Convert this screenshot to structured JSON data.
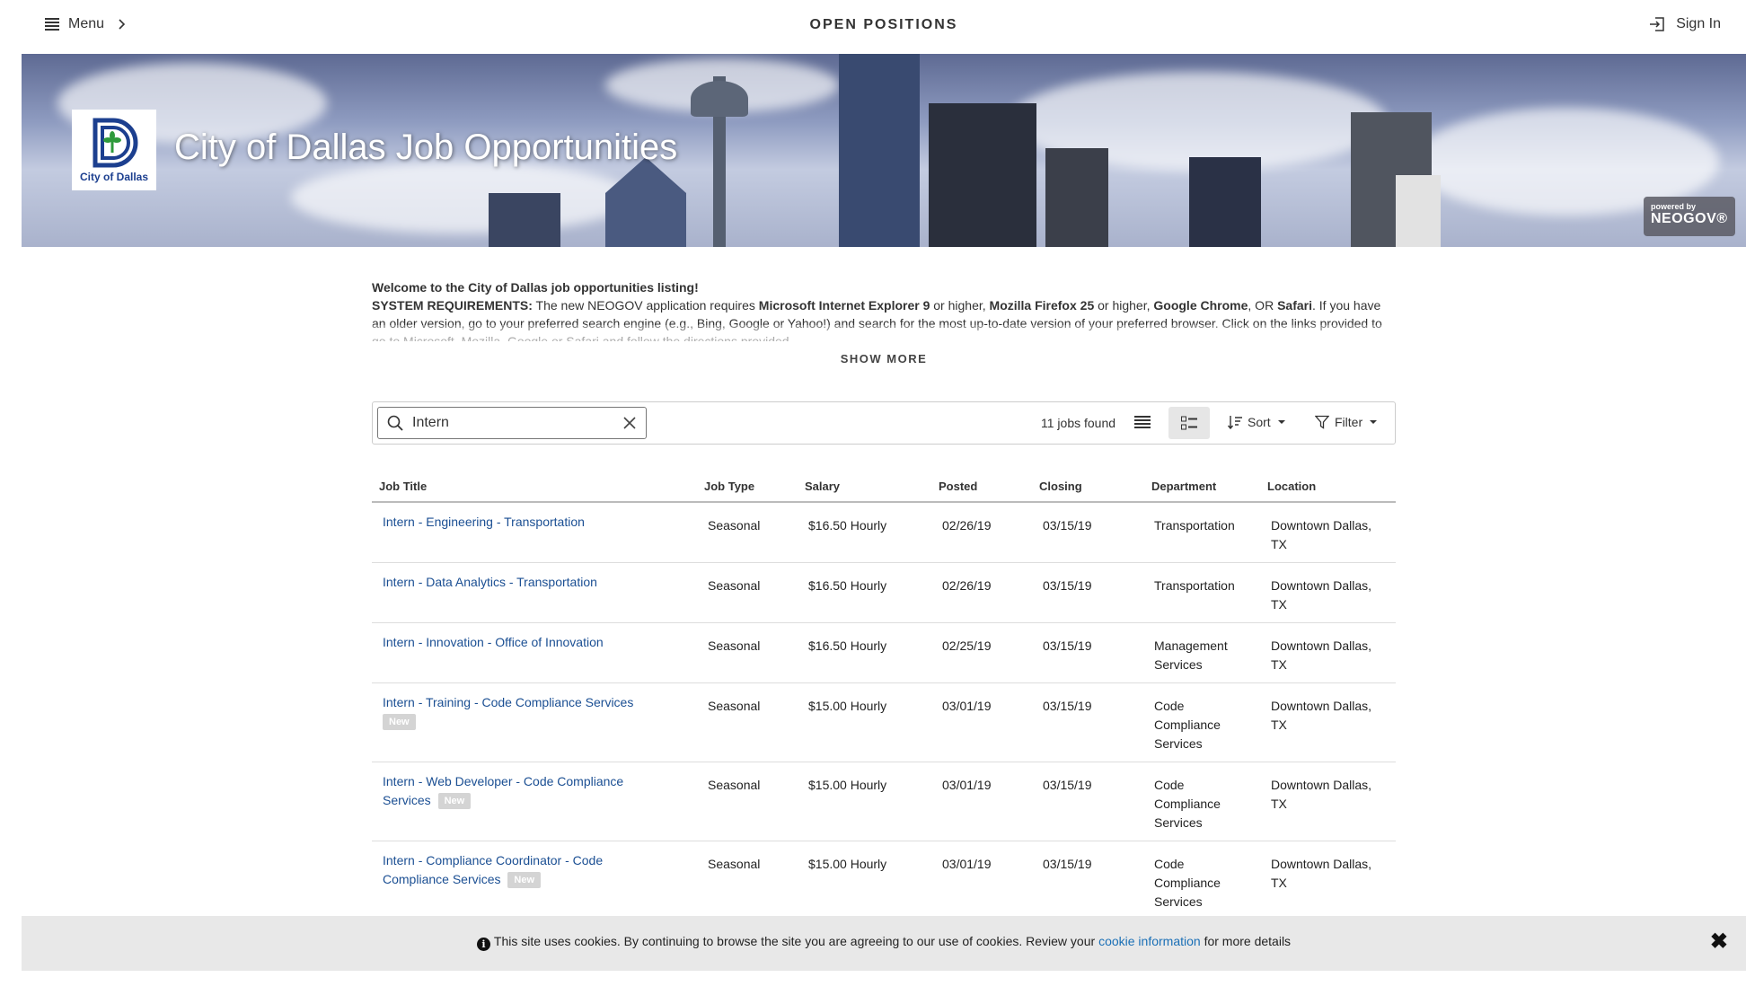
{
  "header": {
    "menu_label": "Menu",
    "page_heading": "OPEN POSITIONS",
    "signin_label": "Sign In"
  },
  "banner": {
    "title": "City of Dallas Job Opportunities",
    "logo_text": "City of Dallas",
    "powered_small": "powered by",
    "powered_big": "NEOGOV®"
  },
  "intro": {
    "welcome": "Welcome to the City of Dallas job opportunities listing!",
    "req_label": "SYSTEM REQUIREMENTS:",
    "req_text_1": " The new NEOGOV application requires ",
    "ie": "Microsoft Internet Explorer 9",
    "req_text_2": " or higher, ",
    "ff": "Mozilla Firefox 25",
    "req_text_3": " or higher, ",
    "chrome": "Google Chrome",
    "req_text_4": ", OR ",
    "safari": "Safari",
    "req_text_5": ". If you have an older version, go to your preferred search engine (e.g., Bing, Google or Yahoo!) and search for the most up-to-date version of your preferred browser. Click on the links provided to go to Microsoft, Mozilla, Google or Safari and follow the directions provided.",
    "show_more": "SHOW MORE"
  },
  "toolbar": {
    "search_value": "Intern",
    "jobs_found": "11 jobs found",
    "sort_label": "Sort",
    "filter_label": "Filter"
  },
  "table": {
    "headers": {
      "title": "Job Title",
      "type": "Job Type",
      "salary": "Salary",
      "posted": "Posted",
      "closing": "Closing",
      "department": "Department",
      "location": "Location"
    },
    "badge_label": "New",
    "rows": [
      {
        "title": "Intern - Engineering - Transportation",
        "type": "Seasonal",
        "salary": "$16.50 Hourly",
        "posted": "02/26/19",
        "closing": "03/15/19",
        "department": "Transportation",
        "location": "Downtown Dallas, TX"
      },
      {
        "title": "Intern - Data Analytics - Transportation",
        "type": "Seasonal",
        "salary": "$16.50 Hourly",
        "posted": "02/26/19",
        "closing": "03/15/19",
        "department": "Transportation",
        "location": "Downtown Dallas, TX"
      },
      {
        "title": "Intern - Innovation - Office of Innovation",
        "type": "Seasonal",
        "salary": "$16.50 Hourly",
        "posted": "02/25/19",
        "closing": "03/15/19",
        "department": "Management Services",
        "location": "Downtown Dallas, TX"
      },
      {
        "title": "Intern - Training - Code Compliance Services",
        "type": "Seasonal",
        "salary": "$15.00 Hourly",
        "posted": "03/01/19",
        "closing": "03/15/19",
        "department": "Code Compliance Services",
        "location": "Downtown Dallas, TX"
      },
      {
        "title": "Intern - Web Developer - Code Compliance Services",
        "type": "Seasonal",
        "salary": "$15.00 Hourly",
        "posted": "03/01/19",
        "closing": "03/15/19",
        "department": "Code Compliance Services",
        "location": "Downtown Dallas, TX"
      },
      {
        "title": "Intern - Compliance Coordinator - Code Compliance Services",
        "type": "Seasonal",
        "salary": "$15.00 Hourly",
        "posted": "03/01/19",
        "closing": "03/15/19",
        "department": "Code Compliance Services",
        "location": "Downtown Dallas, TX"
      }
    ]
  },
  "cookie": {
    "text_before": "This site uses cookies. By continuing to browse the site you are agreeing to our use of cookies. Review your ",
    "link": "cookie information",
    "text_after": " for more details",
    "info_glyph": "i",
    "close_glyph": "✖"
  }
}
